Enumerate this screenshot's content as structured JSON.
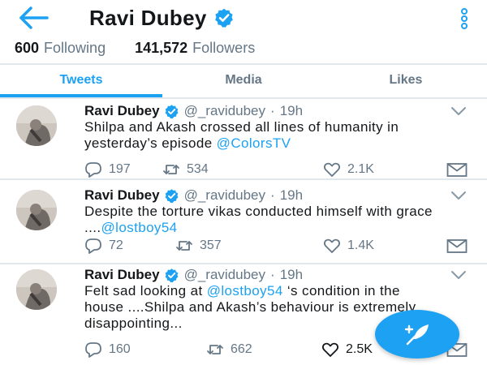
{
  "header": {
    "title": "Ravi Dubey",
    "back_icon": "arrow-left-icon",
    "more_icon": "vertical-dots-icon",
    "verified_icon": "verified-badge-icon"
  },
  "stats": {
    "following_count": "600",
    "following_label": "Following",
    "followers_count": "141,572",
    "followers_label": "Followers"
  },
  "tabs": [
    {
      "label": "Tweets",
      "active": true
    },
    {
      "label": "Media",
      "active": false
    },
    {
      "label": "Likes",
      "active": false
    }
  ],
  "tweets": [
    {
      "name": "Ravi Dubey",
      "handle": "@_ravidubey",
      "dot": "·",
      "time": "19h",
      "text_parts": [
        {
          "text": "Shilpa and Akash crossed all lines of humanity in yesterday’s episode ",
          "mention": false
        },
        {
          "text": "@ColorsTV",
          "mention": true
        }
      ],
      "replies": "197",
      "retweets": "534",
      "likes": "2.1K"
    },
    {
      "name": "Ravi Dubey",
      "handle": "@_ravidubey",
      "dot": "·",
      "time": "19h",
      "text_parts": [
        {
          "text": "Despite the torture vikas conducted himself with grace ....",
          "mention": false
        },
        {
          "text": "@lostboy54",
          "mention": true
        }
      ],
      "replies": "72",
      "retweets": "357",
      "likes": "1.4K"
    },
    {
      "name": "Ravi Dubey",
      "handle": "@_ravidubey",
      "dot": "·",
      "time": "19h",
      "text_parts": [
        {
          "text": "Felt sad looking at ",
          "mention": false
        },
        {
          "text": "@lostboy54",
          "mention": true
        },
        {
          "text": " ‘s condition in the house ....Shilpa and Akash’s behaviour is extremely disappointing...",
          "mention": false
        }
      ],
      "replies": "160",
      "retweets": "662",
      "likes": "2.5K"
    }
  ],
  "icons": {
    "reply": "reply-icon",
    "retweet": "retweet-icon",
    "like": "heart-icon",
    "message": "envelope-icon",
    "caret": "chevron-down-icon",
    "compose": "compose-feather-icon"
  },
  "colors": {
    "accent": "#1da1f2",
    "text": "#14171a",
    "muted": "#657786",
    "divider": "#e1e8ed"
  }
}
